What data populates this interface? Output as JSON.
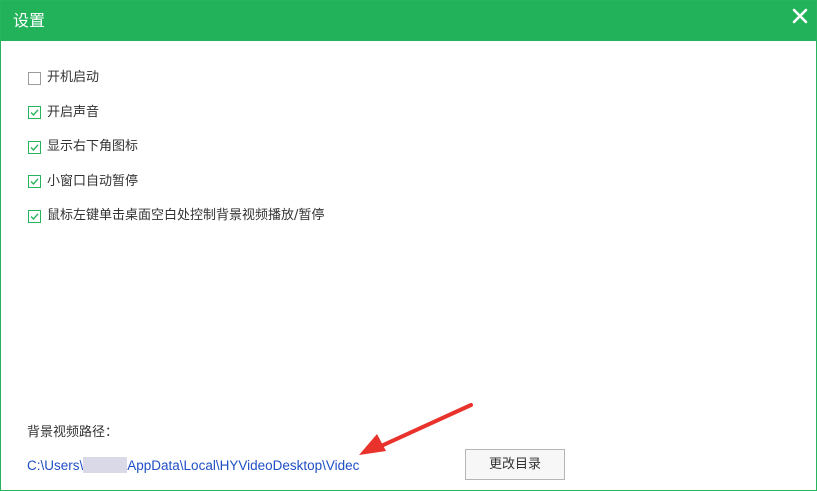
{
  "window": {
    "title": "设置",
    "accent_color": "#22b25a",
    "close_icon": "close-icon"
  },
  "options": [
    {
      "label": "开机启动",
      "checked": false
    },
    {
      "label": "开启声音",
      "checked": true
    },
    {
      "label": "显示右下角图标",
      "checked": true
    },
    {
      "label": "小窗口自动暂停",
      "checked": true
    },
    {
      "label": "鼠标左键单击桌面空白处控制背景视频播放/暂停",
      "checked": true
    }
  ],
  "video_path": {
    "label": "背景视频路径：",
    "value_prefix": "C:\\Users\\",
    "value_suffix": "AppData\\Local\\HYVideoDesktop\\Videc",
    "change_button": "更改目录"
  },
  "annotation": {
    "arrow_color": "#e8322b"
  }
}
